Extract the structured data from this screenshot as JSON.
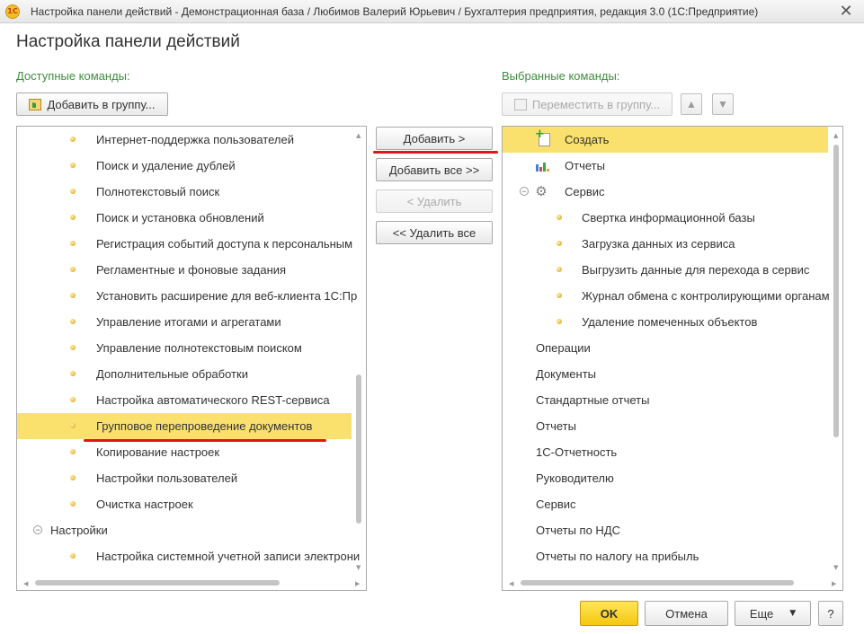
{
  "window": {
    "logo_text": "1С",
    "title": "Настройка панели действий - Демонстрационная база / Любимов Валерий Юрьевич / Бухгалтерия предприятия, редакция 3.0  (1С:Предприятие)",
    "close_glyph": "✕"
  },
  "form": {
    "title": "Настройка панели действий"
  },
  "available": {
    "label": "Доступные команды:",
    "add_to_group_label": "Добавить в группу...",
    "items": [
      {
        "text": "Интернет-поддержка пользователей",
        "kind": "leaf"
      },
      {
        "text": "Поиск и удаление дублей",
        "kind": "leaf"
      },
      {
        "text": "Полнотекстовый поиск",
        "kind": "leaf"
      },
      {
        "text": "Поиск и установка обновлений",
        "kind": "leaf"
      },
      {
        "text": "Регистрация событий доступа к персональным",
        "kind": "leaf"
      },
      {
        "text": "Регламентные и фоновые задания",
        "kind": "leaf"
      },
      {
        "text": "Установить расширение для веб-клиента 1С:Пр",
        "kind": "leaf"
      },
      {
        "text": "Управление итогами и агрегатами",
        "kind": "leaf"
      },
      {
        "text": "Управление полнотекстовым поиском",
        "kind": "leaf"
      },
      {
        "text": "Дополнительные обработки",
        "kind": "leaf"
      },
      {
        "text": "Настройка автоматического REST-сервиса",
        "kind": "leaf"
      },
      {
        "text": "Групповое перепроведение документов",
        "kind": "leaf",
        "selected": true
      },
      {
        "text": "Копирование настроек",
        "kind": "leaf"
      },
      {
        "text": "Настройки пользователей",
        "kind": "leaf"
      },
      {
        "text": "Очистка настроек",
        "kind": "leaf"
      },
      {
        "text": "Настройки",
        "kind": "group"
      },
      {
        "text": "Настройка системной учетной записи электрони",
        "kind": "leaf"
      }
    ]
  },
  "middle": {
    "add_label": "Добавить >",
    "add_all_label": "Добавить все >>",
    "remove_label": "< Удалить",
    "remove_all_label": "<< Удалить все"
  },
  "selected": {
    "label": "Выбранные команды:",
    "move_to_group_label": "Переместить в группу...",
    "up_glyph": "▲",
    "down_glyph": "▼",
    "items": [
      {
        "text": "Создать",
        "kind": "create",
        "selected": true
      },
      {
        "text": "Отчеты",
        "kind": "chart"
      },
      {
        "text": "Сервис",
        "kind": "gear"
      },
      {
        "text": "Свертка информационной базы",
        "kind": "leaf"
      },
      {
        "text": "Загрузка данных из сервиса",
        "kind": "leaf"
      },
      {
        "text": "Выгрузить данные для перехода в сервис",
        "kind": "leaf"
      },
      {
        "text": "Журнал обмена с контролирующими органам",
        "kind": "leaf"
      },
      {
        "text": "Удаление помеченных объектов",
        "kind": "leaf"
      },
      {
        "text": "Операции",
        "kind": "plain"
      },
      {
        "text": "Документы",
        "kind": "plain"
      },
      {
        "text": "Стандартные отчеты",
        "kind": "plain"
      },
      {
        "text": "Отчеты",
        "kind": "plain"
      },
      {
        "text": "1С-Отчетность",
        "kind": "plain"
      },
      {
        "text": "Руководителю",
        "kind": "plain"
      },
      {
        "text": "Сервис",
        "kind": "plain"
      },
      {
        "text": "Отчеты по НДС",
        "kind": "plain"
      },
      {
        "text": "Отчеты по налогу на прибыль",
        "kind": "plain"
      }
    ]
  },
  "footer": {
    "ok_label": "OK",
    "cancel_label": "Отмена",
    "more_label": "Еще",
    "more_arrow": "▼",
    "help_label": "?"
  },
  "colors": {
    "section_label": "#3d8e3d",
    "selection": "#fae16e",
    "ok_button": "#f5c70d",
    "annotation_underline": "#e3151b"
  }
}
